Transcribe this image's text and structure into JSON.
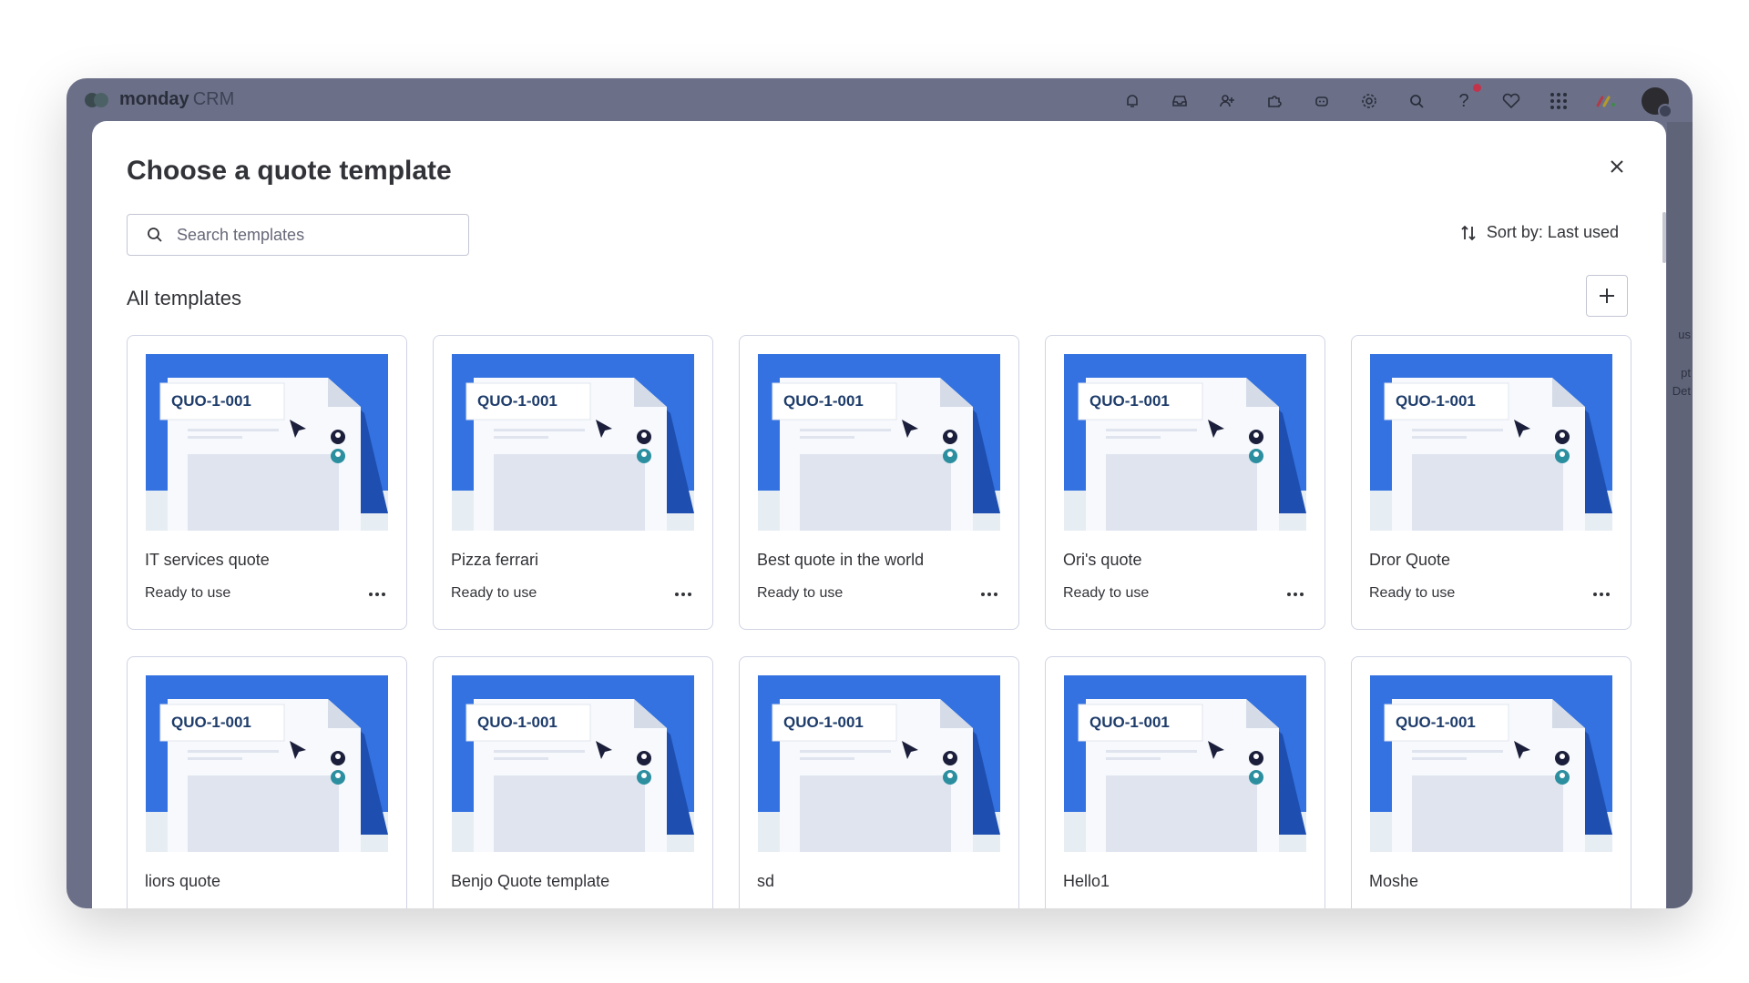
{
  "app": {
    "brand": "monday",
    "product": "CRM"
  },
  "modal": {
    "title": "Choose a quote template",
    "search_placeholder": "Search templates",
    "sort_label": "Sort by: Last used",
    "section_title": "All templates"
  },
  "thumbnail_code": "QUO-1-001",
  "side_fragments": [
    "us",
    "pt",
    "Det"
  ],
  "templates": [
    {
      "name": "IT services quote",
      "status": "Ready to use"
    },
    {
      "name": "Pizza ferrari",
      "status": "Ready to use"
    },
    {
      "name": "Best quote in the world",
      "status": "Ready to use"
    },
    {
      "name": "Ori's quote",
      "status": "Ready to use"
    },
    {
      "name": "Dror Quote",
      "status": "Ready to use"
    },
    {
      "name": "liors quote",
      "status": ""
    },
    {
      "name": "Benjo Quote template",
      "status": ""
    },
    {
      "name": "sd",
      "status": ""
    },
    {
      "name": "Hello1",
      "status": ""
    },
    {
      "name": "Moshe",
      "status": ""
    }
  ],
  "top_icons": [
    "bell-icon",
    "inbox-icon",
    "invite-icon",
    "apps-icon",
    "ai-icon",
    "settings-icon",
    "search-icon",
    "help-icon",
    "heart-icon",
    "grid-icon",
    "monday-logo-icon"
  ],
  "colors": {
    "thumbnail_blue": "#3372e0",
    "accent_red": "#c3334a",
    "window_bg": "#6b7088",
    "text": "#323338"
  }
}
